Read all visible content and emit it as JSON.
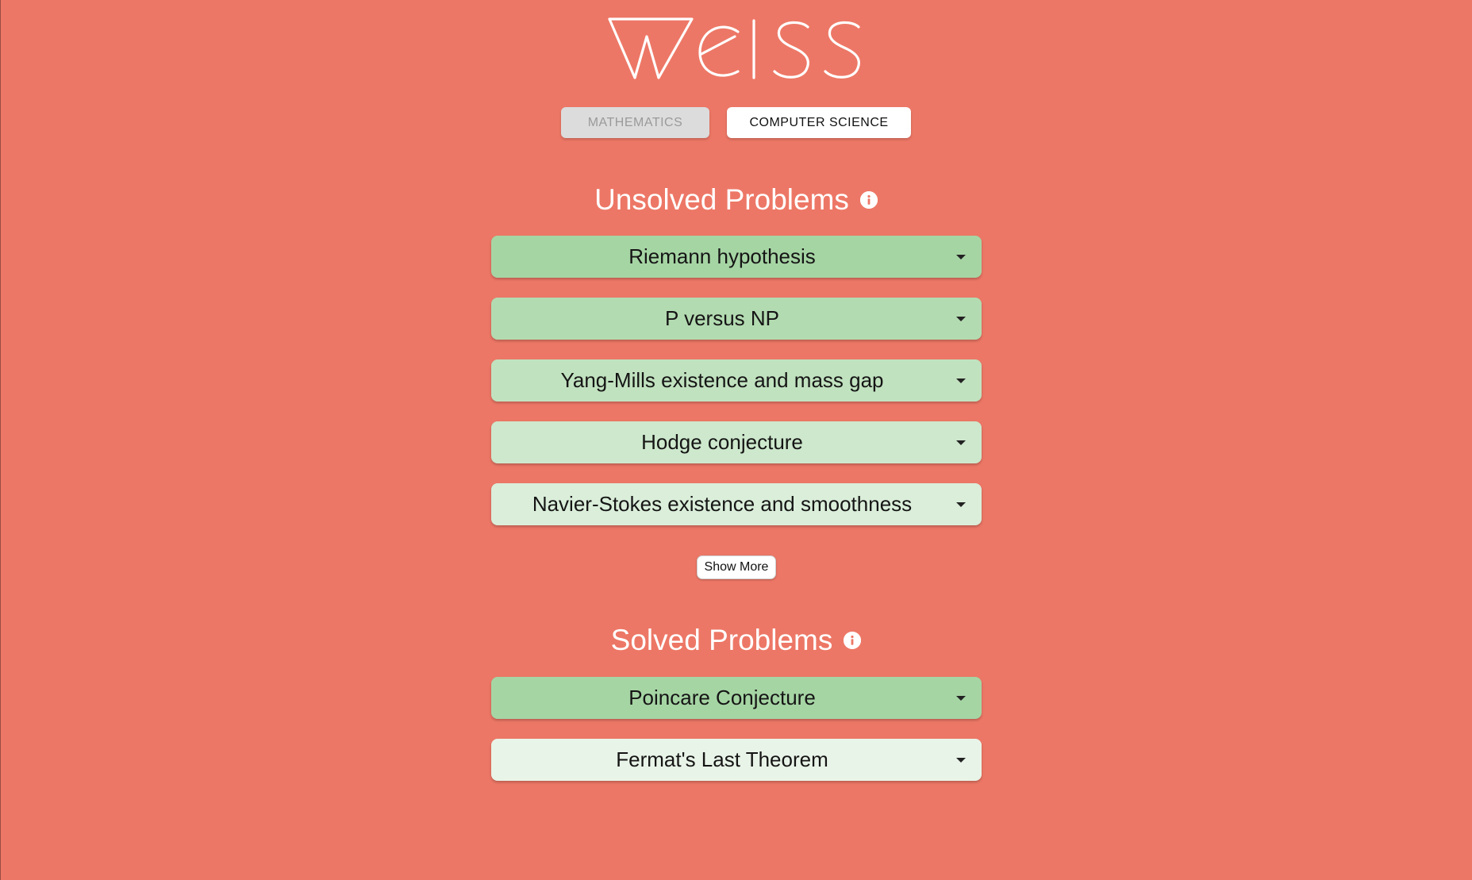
{
  "brand": {
    "logo_text": "WeISS"
  },
  "tabs": [
    {
      "label": "Mathematics",
      "active": false
    },
    {
      "label": "Computer Science",
      "active": true
    }
  ],
  "unsolved": {
    "title": "Unsolved Problems",
    "items": [
      {
        "label": "Riemann hypothesis",
        "color": "#a6d5a4"
      },
      {
        "label": "P versus NP",
        "color": "#b3dbb1"
      },
      {
        "label": "Yang-Mills existence and mass gap",
        "color": "#c1e2bf"
      },
      {
        "label": "Hodge conjecture",
        "color": "#cde8cc"
      },
      {
        "label": "Navier-Stokes existence and smoothness",
        "color": "#daeeda"
      }
    ],
    "show_more_label": "Show More"
  },
  "solved": {
    "title": "Solved Problems",
    "items": [
      {
        "label": "Poincare Conjecture",
        "color": "#a6d5a4"
      },
      {
        "label": "Fermat's Last Theorem",
        "color": "#e9f4e8"
      }
    ]
  },
  "colors": {
    "background": "#ed7766",
    "tab_active_bg": "#ffffff",
    "tab_inactive_bg": "#dcdcdc"
  }
}
